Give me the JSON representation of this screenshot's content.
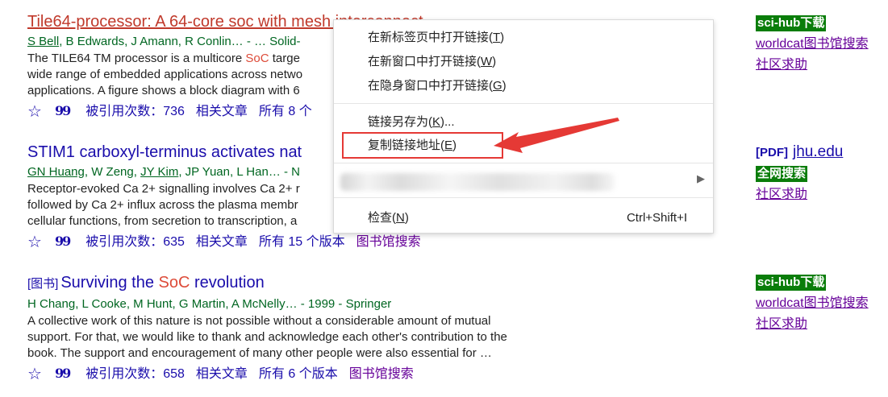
{
  "results": [
    {
      "title_prefix": "Tile64-processor: A 64-core soc with mesh interconnect",
      "authors": [
        "S Bell",
        "B Edwards",
        "J Amann",
        "R Conlin…"
      ],
      "authors_tail": " - … Solid-",
      "snippet_lines": [
        "The TILE64 TM processor is a multicore ",
        "wide range of embedded applications across netwo",
        "applications. A figure shows a block diagram with 6"
      ],
      "snippet_hl": "SoC",
      "snippet_after_hl": " targe",
      "cited": "被引用次数：736",
      "related": "相关文章",
      "versions": "所有 8 个"
    },
    {
      "title": "STIM1 carboxyl-terminus activates nat",
      "authors_html_parts": [
        "GN Huang",
        "W Zeng",
        "JY Kim",
        "JP Yuan",
        "L Han…"
      ],
      "authors_tail": " - N",
      "snippet_lines": [
        "Receptor-evoked Ca 2+ signalling involves Ca 2+ r",
        "followed by Ca 2+ influx across the plasma membr",
        "cellular functions, from secretion to transcription, a"
      ],
      "cited": "被引用次数：635",
      "related": "相关文章",
      "versions": "所有 15 个版本",
      "library": "图书馆搜索"
    },
    {
      "tag": "[图书]",
      "title_a": "Surviving the ",
      "title_hl": "SoC",
      "title_b": " revolution",
      "authors_text": "H Chang, L Cooke, M Hunt, G Martin, A McNelly… - 1999 - Springer",
      "snippet_lines": [
        "A collective work of this nature is not possible without a considerable amount of mutual",
        "support. For that, we would like to thank and acknowledge each other's contribution to the",
        "book. The support and encouragement of many other people were also essential for …"
      ],
      "cited": "被引用次数：658",
      "related": "相关文章",
      "versions": "所有 6 个版本",
      "library": "图书馆搜索"
    }
  ],
  "sidebar": [
    {
      "badge": "sci-hub下载",
      "links": [
        "worldcat图书馆搜索",
        "社区求助"
      ]
    },
    {
      "pdf": "[PDF]",
      "domain": "jhu.edu",
      "badge": "全网搜索",
      "links": [
        "社区求助"
      ]
    },
    {
      "badge": "sci-hub下载",
      "links": [
        "worldcat图书馆搜索",
        "社区求助"
      ]
    }
  ],
  "context_menu": {
    "open_new_tab": "在新标签页中打开链接(",
    "open_new_tab_key": "T",
    "open_new_window": "在新窗口中打开链接(",
    "open_new_window_key": "W",
    "open_incognito": "在隐身窗口中打开链接(",
    "open_incognito_key": "G",
    "save_link": "链接另存为(",
    "save_link_key": "K",
    "save_link_tail": ")...",
    "copy_link": "复制链接地址(",
    "copy_link_key": "E",
    "inspect": "检查(",
    "inspect_key": "N",
    "inspect_shortcut": "Ctrl+Shift+I",
    "close_paren": ")"
  },
  "colors": {
    "annotation": "#e53935",
    "badge_bg": "#0a7d0a",
    "link": "#1a0dab",
    "visited": "#660099"
  }
}
